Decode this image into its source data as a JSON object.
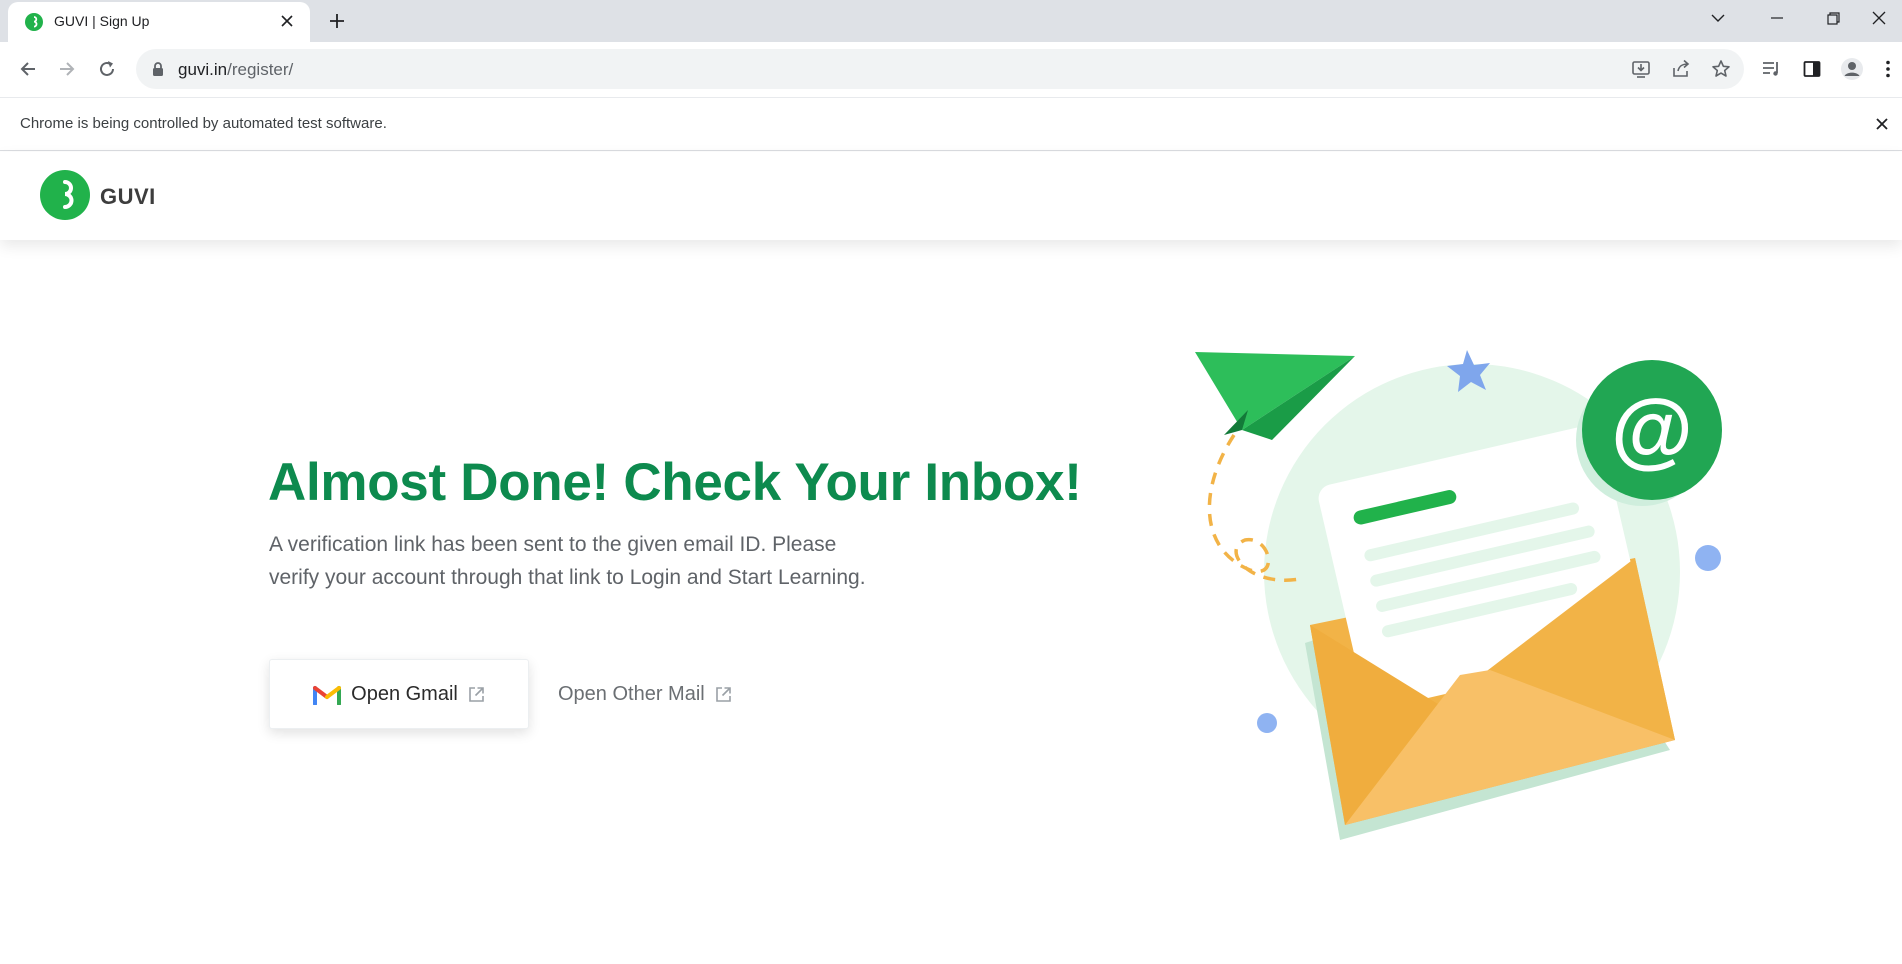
{
  "browser": {
    "tab_title": "GUVI | Sign Up",
    "url_host": "guvi.in",
    "url_path": "/register/",
    "infobar_text": "Chrome is being controlled by automated test software."
  },
  "site": {
    "logo_text": "GUVI",
    "brand_color": "#0d8a4e",
    "logo_color": "#21b24b"
  },
  "main": {
    "headline": "Almost Done! Check Your Inbox!",
    "subtext_line1": "A verification link has been sent to the given email ID. Please",
    "subtext_line2": "verify your account through that link to Login and Start Learning.",
    "open_gmail_label": "Open Gmail",
    "open_other_mail_label": "Open Other Mail",
    "illustration_at_sign": "@"
  }
}
